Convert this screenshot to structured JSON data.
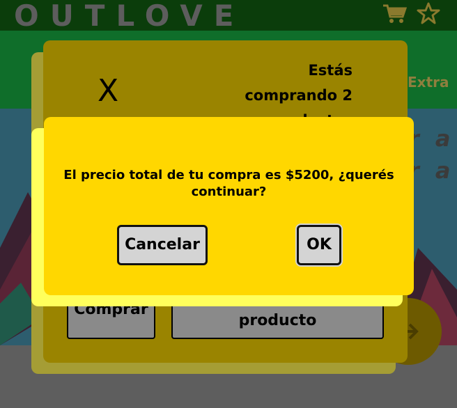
{
  "header": {
    "logo": "OUTLOVE",
    "cart_icon": "cart-icon",
    "favorite_icon": "star-icon",
    "nav_extra": "Extra"
  },
  "background": {
    "banner_text_1": "r a",
    "banner_text_2": "r a"
  },
  "purchase_modal": {
    "close_label": "X",
    "summary": "Estás comprando 2 productos",
    "buy_button": "Comprar",
    "second_button": "producto"
  },
  "confirm_dialog": {
    "message": "El precio total de tu compra es $5200, ¿querés continuar?",
    "cancel_label": "Cancelar",
    "ok_label": "OK"
  },
  "colors": {
    "dialog_bg": "#ffd700",
    "modal_bg": "#9a8400",
    "topbar": "#0b3d0b"
  }
}
